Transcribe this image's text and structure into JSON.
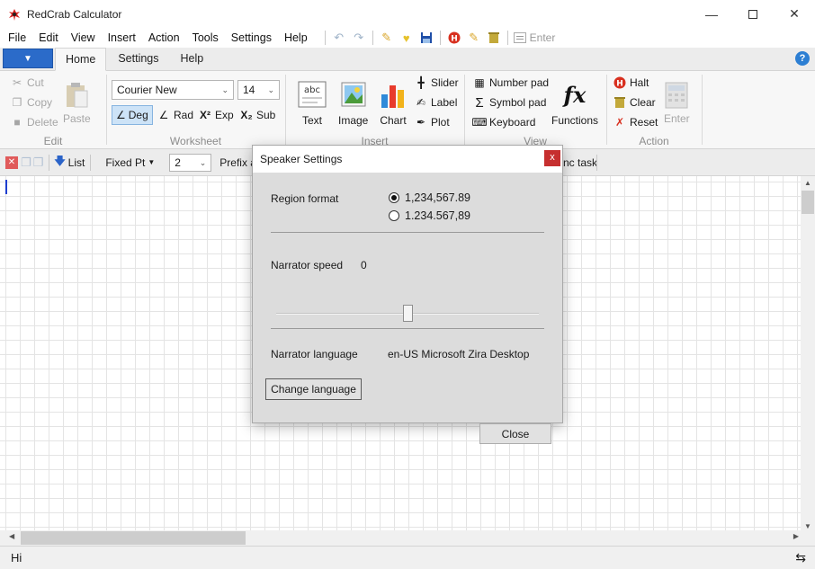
{
  "window": {
    "title": "RedCrab Calculator"
  },
  "menu": [
    "File",
    "Edit",
    "View",
    "Insert",
    "Action",
    "Tools",
    "Settings",
    "Help"
  ],
  "qat": {
    "enter_label": "Enter"
  },
  "ribbon_tabs": [
    "Home",
    "Settings",
    "Help"
  ],
  "ribbon": {
    "edit": {
      "cut": "Cut",
      "copy": "Copy",
      "delete": "Delete",
      "paste": "Paste",
      "label": "Edit"
    },
    "worksheet": {
      "font": "Courier New",
      "size": "14",
      "deg": "Deg",
      "rad": "Rad",
      "exp": "Exp",
      "sub": "Sub",
      "label": "Worksheet"
    },
    "insert": {
      "text": "Text",
      "image": "Image",
      "chart": "Chart",
      "slider": "Slider",
      "label_btn": "Label",
      "plot": "Plot",
      "label": "Insert"
    },
    "view": {
      "number_pad": "Number pad",
      "symbol_pad": "Symbol pad",
      "keyboard": "Keyboard",
      "functions": "Functions",
      "label": "View"
    },
    "action": {
      "halt": "Halt",
      "clear": "Clear",
      "reset": "Reset",
      "enter": "Enter",
      "label": "Action"
    }
  },
  "toolbar": {
    "list": "List",
    "fixed_pt": "Fixed Pt",
    "digits": "2",
    "prefix": "Prefix a",
    "sync_task": "nc task"
  },
  "status": {
    "text": "Hi"
  },
  "dialog": {
    "title": "Speaker Settings",
    "close_x": "x",
    "region_format_label": "Region format",
    "region_options": [
      "1,234,567.89",
      "1.234.567,89"
    ],
    "narrator_speed_label": "Narrator speed",
    "narrator_speed_value": "0",
    "narrator_speed_level": 0.5,
    "narrator_language_label": "Narrator language",
    "narrator_language_value": "en-US Microsoft Zira Desktop",
    "change_language_button": "Change language",
    "close_button": "Close"
  }
}
